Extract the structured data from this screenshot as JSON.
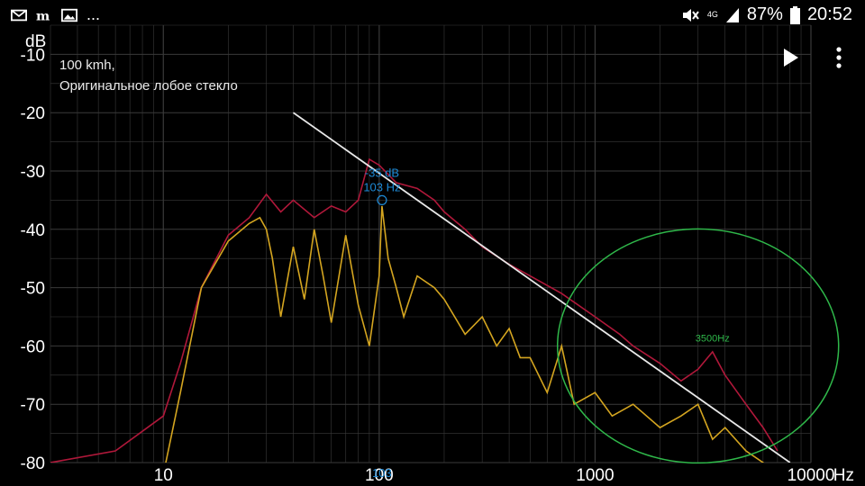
{
  "statusbar": {
    "left_icons": [
      "mail-icon",
      "mi-icon",
      "image-icon"
    ],
    "more": "...",
    "network": "4G",
    "battery": "87%",
    "time": "20:52"
  },
  "overlay": {
    "line1": "100 kmh,",
    "line2": "Оригинальное лобое стекло"
  },
  "colors": {
    "background": "#000000",
    "grid": "#3a3a3a",
    "series_red": "#b0183a",
    "series_yellow": "#d4a520",
    "trend": "#e8e8e8",
    "ellipse": "#2fb84a",
    "marker": "#1e8ad6",
    "tick_text": "#ffffff"
  },
  "chart_data": {
    "type": "line",
    "xscale": "log",
    "xlim": [
      3,
      10000
    ],
    "ylim": [
      -80,
      -5
    ],
    "y_unit": "dB",
    "x_unit": "Hz",
    "y_ticks": [
      -10,
      -20,
      -30,
      -40,
      -50,
      -60,
      -70,
      -80
    ],
    "x_ticks": [
      10,
      100,
      1000,
      10000
    ],
    "series": [
      {
        "x": [
          3,
          6,
          10,
          12,
          15,
          20,
          25,
          30,
          35,
          40,
          50,
          60,
          70,
          80,
          90,
          100,
          120,
          150,
          180,
          200,
          250,
          300,
          400,
          500,
          700,
          1000,
          1300,
          1500,
          2000,
          2500,
          3000,
          3500,
          4000,
          5000,
          6000,
          7000
        ],
        "y": [
          -80,
          -78,
          -72,
          -63,
          -50,
          -41,
          -38,
          -34,
          -37,
          -35,
          -38,
          -36,
          -37,
          -35,
          -28,
          -29,
          -32,
          -33,
          -35,
          -37,
          -40,
          -43,
          -46,
          -48,
          -51,
          -55,
          -58,
          -60,
          -63,
          -66,
          -64,
          -61,
          -65,
          -70,
          -74,
          -78
        ]
      },
      {
        "x": [
          8,
          10,
          12,
          15,
          20,
          25,
          28,
          30,
          32,
          35,
          40,
          45,
          50,
          55,
          60,
          70,
          80,
          90,
          100,
          103,
          110,
          120,
          130,
          150,
          180,
          200,
          250,
          300,
          350,
          400,
          450,
          500,
          600,
          700,
          800,
          1000,
          1200,
          1500,
          2000,
          2500,
          3000,
          3500,
          4000,
          5000,
          6000,
          7000
        ],
        "y": [
          -90,
          -82,
          -68,
          -50,
          -42,
          -39,
          -38,
          -40,
          -45,
          -55,
          -43,
          -52,
          -40,
          -48,
          -56,
          -41,
          -53,
          -60,
          -48,
          -36,
          -45,
          -50,
          -55,
          -48,
          -50,
          -52,
          -58,
          -55,
          -60,
          -57,
          -62,
          -62,
          -68,
          -60,
          -70,
          -68,
          -72,
          -70,
          -74,
          -72,
          -70,
          -76,
          -74,
          -78,
          -80,
          -82
        ]
      },
      {
        "x": [
          40,
          8000
        ],
        "y": [
          -20,
          -80
        ]
      }
    ],
    "annotations": [
      {
        "text": "-35 dB",
        "x": 103,
        "y": -35
      },
      {
        "text": "103 Hz",
        "x": 103,
        "y": -35
      },
      {
        "text": "103",
        "x": 103,
        "y": -80
      },
      {
        "text": "3500Hz",
        "x": 3500,
        "y": -58
      }
    ],
    "highlight": {
      "shape": "ellipse",
      "center_x": 3000,
      "center_y": -60,
      "label": "3500Hz"
    }
  }
}
